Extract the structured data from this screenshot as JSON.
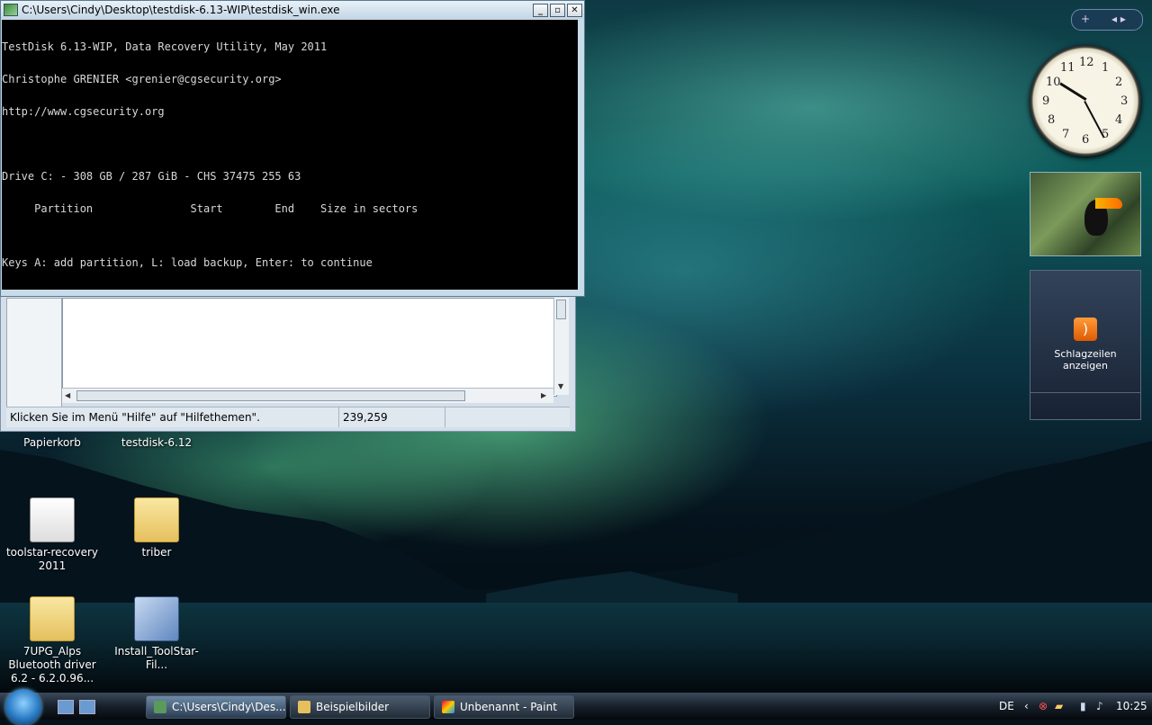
{
  "console": {
    "title": "C:\\Users\\Cindy\\Desktop\\testdisk-6.13-WIP\\testdisk_win.exe",
    "minimize": "_",
    "maximize": "▫",
    "close": "✕",
    "lines": [
      "TestDisk 6.13-WIP, Data Recovery Utility, May 2011",
      "Christophe GRENIER <grenier@cgsecurity.org>",
      "http://www.cgsecurity.org",
      "",
      "Drive C: - 308 GB / 287 GiB - CHS 37475 255 63",
      "     Partition               Start        End    Size in sectors"
    ],
    "footer": "Keys A: add partition, L: load backup, Enter: to continue"
  },
  "paint": {
    "status_help": "Klicken Sie im Menü \"Hilfe\" auf \"Hilfethemen\".",
    "status_coords": "239,259"
  },
  "desktop_icons": [
    {
      "label": "Papierkorb"
    },
    {
      "label": "testdisk-6.12"
    },
    {
      "label": "toolstar-recovery 2011"
    },
    {
      "label": "triber"
    },
    {
      "label": "7UPG_Alps Bluetooth driver 6.2 - 6.2.0.96..."
    },
    {
      "label": "Install_ToolStar-Fil..."
    }
  ],
  "gadgets": {
    "add": "+",
    "nav": "◂ ▸",
    "feeds_label": "Schlagzeilen anzeigen",
    "clock_numbers": [
      "12",
      "1",
      "2",
      "3",
      "4",
      "5",
      "6",
      "7",
      "8",
      "9",
      "10",
      "11"
    ]
  },
  "taskbar": {
    "tasks": [
      {
        "label": "C:\\Users\\Cindy\\Des..."
      },
      {
        "label": "Beispielbilder"
      },
      {
        "label": "Unbenannt - Paint"
      }
    ],
    "language": "DE",
    "time": "10:25"
  }
}
